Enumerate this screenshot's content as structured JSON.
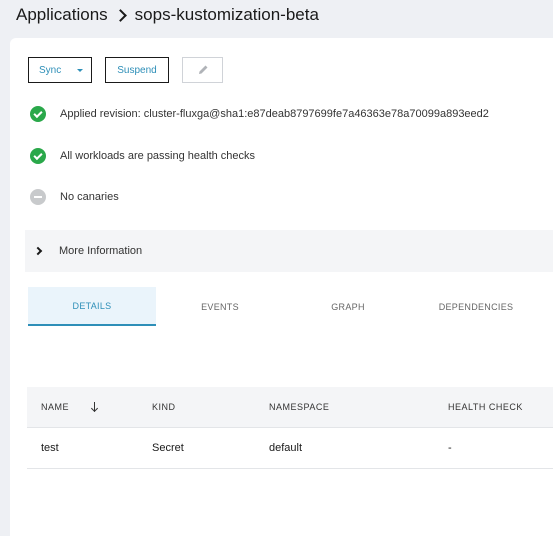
{
  "breadcrumb": {
    "root": "Applications",
    "current": "sops-kustomization-beta"
  },
  "toolbar": {
    "sync_label": "Sync",
    "suspend_label": "Suspend",
    "edit_icon": "pencil-icon"
  },
  "status": {
    "revision": "Applied revision: cluster-fluxga@sha1:e87deab8797699fe7a46363e78a70099a893eed2",
    "health": "All workloads are passing health checks",
    "canaries": "No canaries"
  },
  "more_info": {
    "label": "More Information"
  },
  "tabs": [
    {
      "label": "DETAILS",
      "active": true
    },
    {
      "label": "EVENTS",
      "active": false
    },
    {
      "label": "GRAPH",
      "active": false
    },
    {
      "label": "DEPENDENCIES",
      "active": false
    }
  ],
  "table": {
    "columns": [
      "NAME",
      "KIND",
      "NAMESPACE",
      "HEALTH CHECK"
    ],
    "rows": [
      {
        "name": "test",
        "kind": "Secret",
        "namespace": "default",
        "health": "-"
      }
    ]
  },
  "colors": {
    "accent": "#2e8fb8",
    "success": "#2aa84a",
    "neutral": "#c8cacc"
  }
}
